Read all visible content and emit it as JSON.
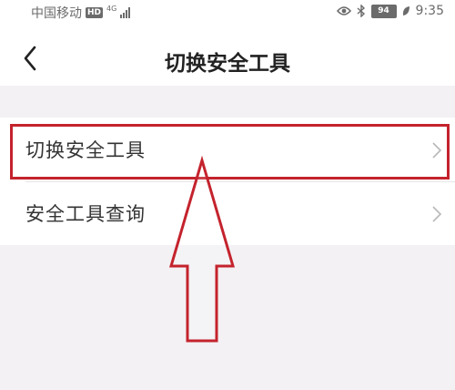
{
  "status_bar": {
    "carrier": "中国移动",
    "hd_badge": "HD",
    "network": "4G",
    "battery": "94",
    "time": "9:35"
  },
  "header": {
    "title": "切换安全工具"
  },
  "menu": {
    "items": [
      {
        "label": "切换安全工具"
      },
      {
        "label": "安全工具查询"
      }
    ]
  },
  "colors": {
    "highlight": "#c4232d",
    "background": "#f3f1f4"
  }
}
